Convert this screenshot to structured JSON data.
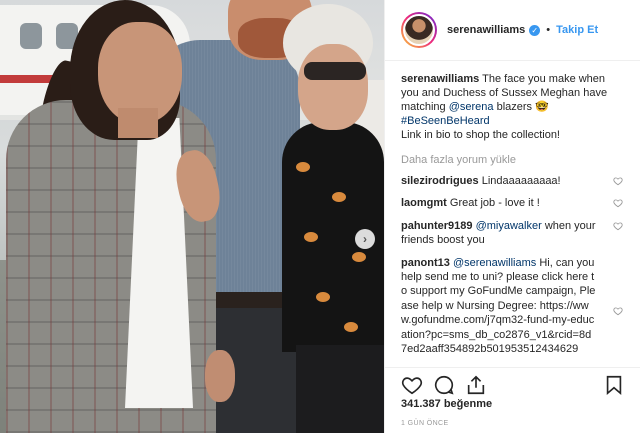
{
  "post": {
    "username": "serenawilliams",
    "follow_label": "Takip Et",
    "separator": "•",
    "caption_user": "serenawilliams",
    "caption_text": " The face you make when you and Duchess of Sussex Meghan have matching ",
    "caption_mention": "@serena",
    "caption_after": " blazers 🤓",
    "caption_hashtag": "#BeSeenBeHeard",
    "caption_link": "Link in bio to shop the collection!",
    "load_more": "Daha fazla yorum yükle",
    "comments": [
      {
        "user": "silezirodrigues",
        "text": " Lindaaaaaaaaa!"
      },
      {
        "user": "laomgmt",
        "text": " Great job - love it !"
      },
      {
        "user": "pahunter9189",
        "mention": " @miyawalker",
        "text": " when your friends boost you"
      },
      {
        "user": "panont13",
        "mention": " @serenawilliams",
        "text": " Hi, can you help send me to uni? please click here to support my GoFundMe campaign, Please help w Nursing Degree: https://www.gofundme.com/j7qm32-fund-my-education?pc=sms_db_co2876_v1&rcid=8d7ed2aaff354892b501953512434629"
      }
    ],
    "likes": "341.387 beğenme",
    "time": "1 GÜN ÖNCE"
  },
  "icons": {
    "verified": "verified-badge-icon",
    "heart": "heart-icon",
    "comment": "comment-icon",
    "share": "share-icon",
    "bookmark": "bookmark-icon",
    "next": "chevron-right-icon"
  },
  "colors": {
    "accent": "#3897f0",
    "link": "#003569",
    "muted": "#999999",
    "text": "#262626"
  }
}
